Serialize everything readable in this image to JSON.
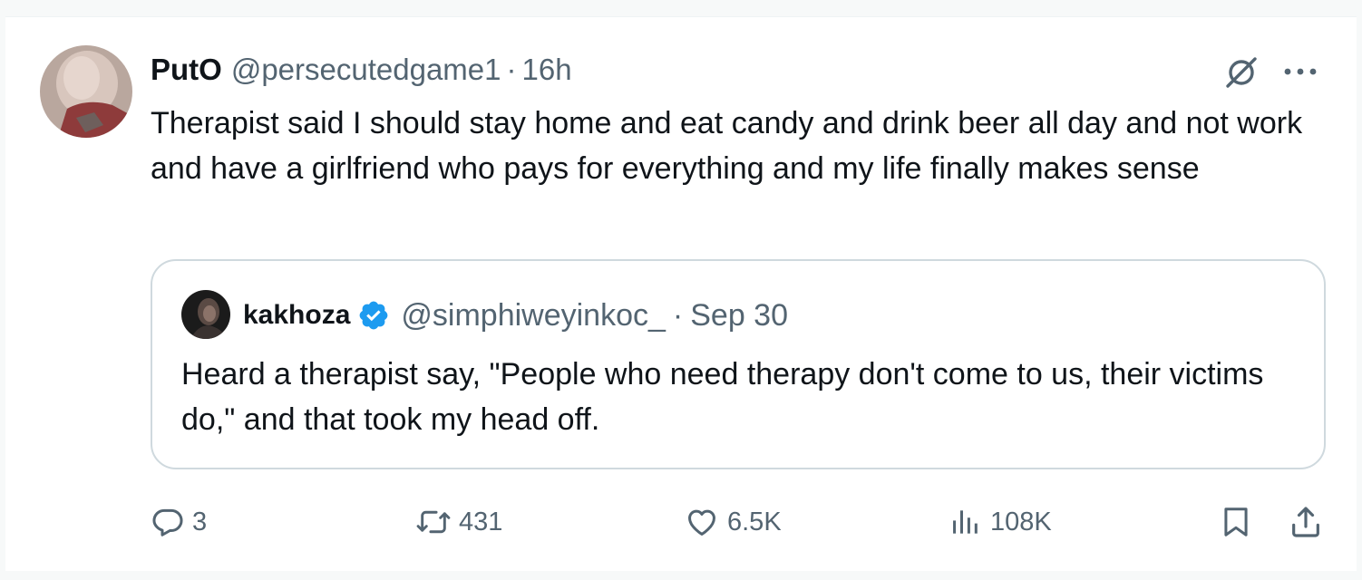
{
  "tweet": {
    "author": {
      "display_name": "PutO",
      "handle": "@persecutedgame1",
      "separator": "·",
      "time": "16h"
    },
    "text": "Therapist said I should stay home and eat candy and drink beer all day and not work and have a girlfriend who pays for everything and my life finally makes sense",
    "quote": {
      "display_name": "kakhoza",
      "handle": "@simphiweyinkoc_",
      "separator": "·",
      "date": "Sep 30",
      "text": "Heard a therapist say, \"People who need therapy don't come to us, their victims do,\" and that took my head off."
    },
    "actions": {
      "replies": "3",
      "reposts": "431",
      "likes": "6.5K",
      "views": "108K"
    }
  },
  "icons": {
    "grok": "grok-icon",
    "more": "more-icon",
    "verified": "verified-badge-icon",
    "reply": "reply-icon",
    "repost": "repost-icon",
    "like": "heart-icon",
    "views": "views-chart-icon",
    "bookmark": "bookmark-icon",
    "share": "share-icon"
  },
  "colors": {
    "text_primary": "#0f1419",
    "text_secondary": "#536471",
    "border": "#cfd9de",
    "verified": "#1d9bf0"
  }
}
